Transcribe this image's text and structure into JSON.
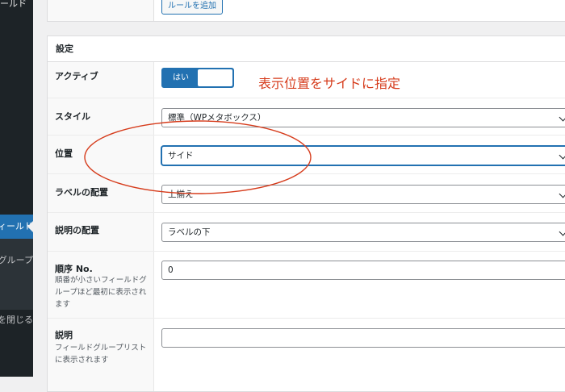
{
  "sidebar": {
    "top_label": "ールド",
    "active_item": "フィールド",
    "group_item": "グループ",
    "collapse_item": "メニューを閉じる"
  },
  "rules": {
    "add_rule_button": "ルールを追加"
  },
  "settings": {
    "title": "設定",
    "active": {
      "label": "アクティブ",
      "toggle_text": "はい",
      "value": true
    },
    "annotation": "表示位置をサイドに指定",
    "style": {
      "label": "スタイル",
      "value": "標準（WPメタボックス）"
    },
    "position": {
      "label": "位置",
      "value": "サイド"
    },
    "label_placement": {
      "label": "ラベルの配置",
      "value": "上揃え"
    },
    "instruction_placement": {
      "label": "説明の配置",
      "value": "ラベルの下"
    },
    "order": {
      "label": "順序 No.",
      "description": "順番が小さいフィールドグループほど最初に表示されます",
      "value": "0"
    },
    "description": {
      "label": "説明",
      "description": "フィールドグループリストに表示されます",
      "value": ""
    }
  },
  "colors": {
    "accent": "#2271b1",
    "annotation": "#d63c1c",
    "sidebar_bg": "#1d2327"
  }
}
